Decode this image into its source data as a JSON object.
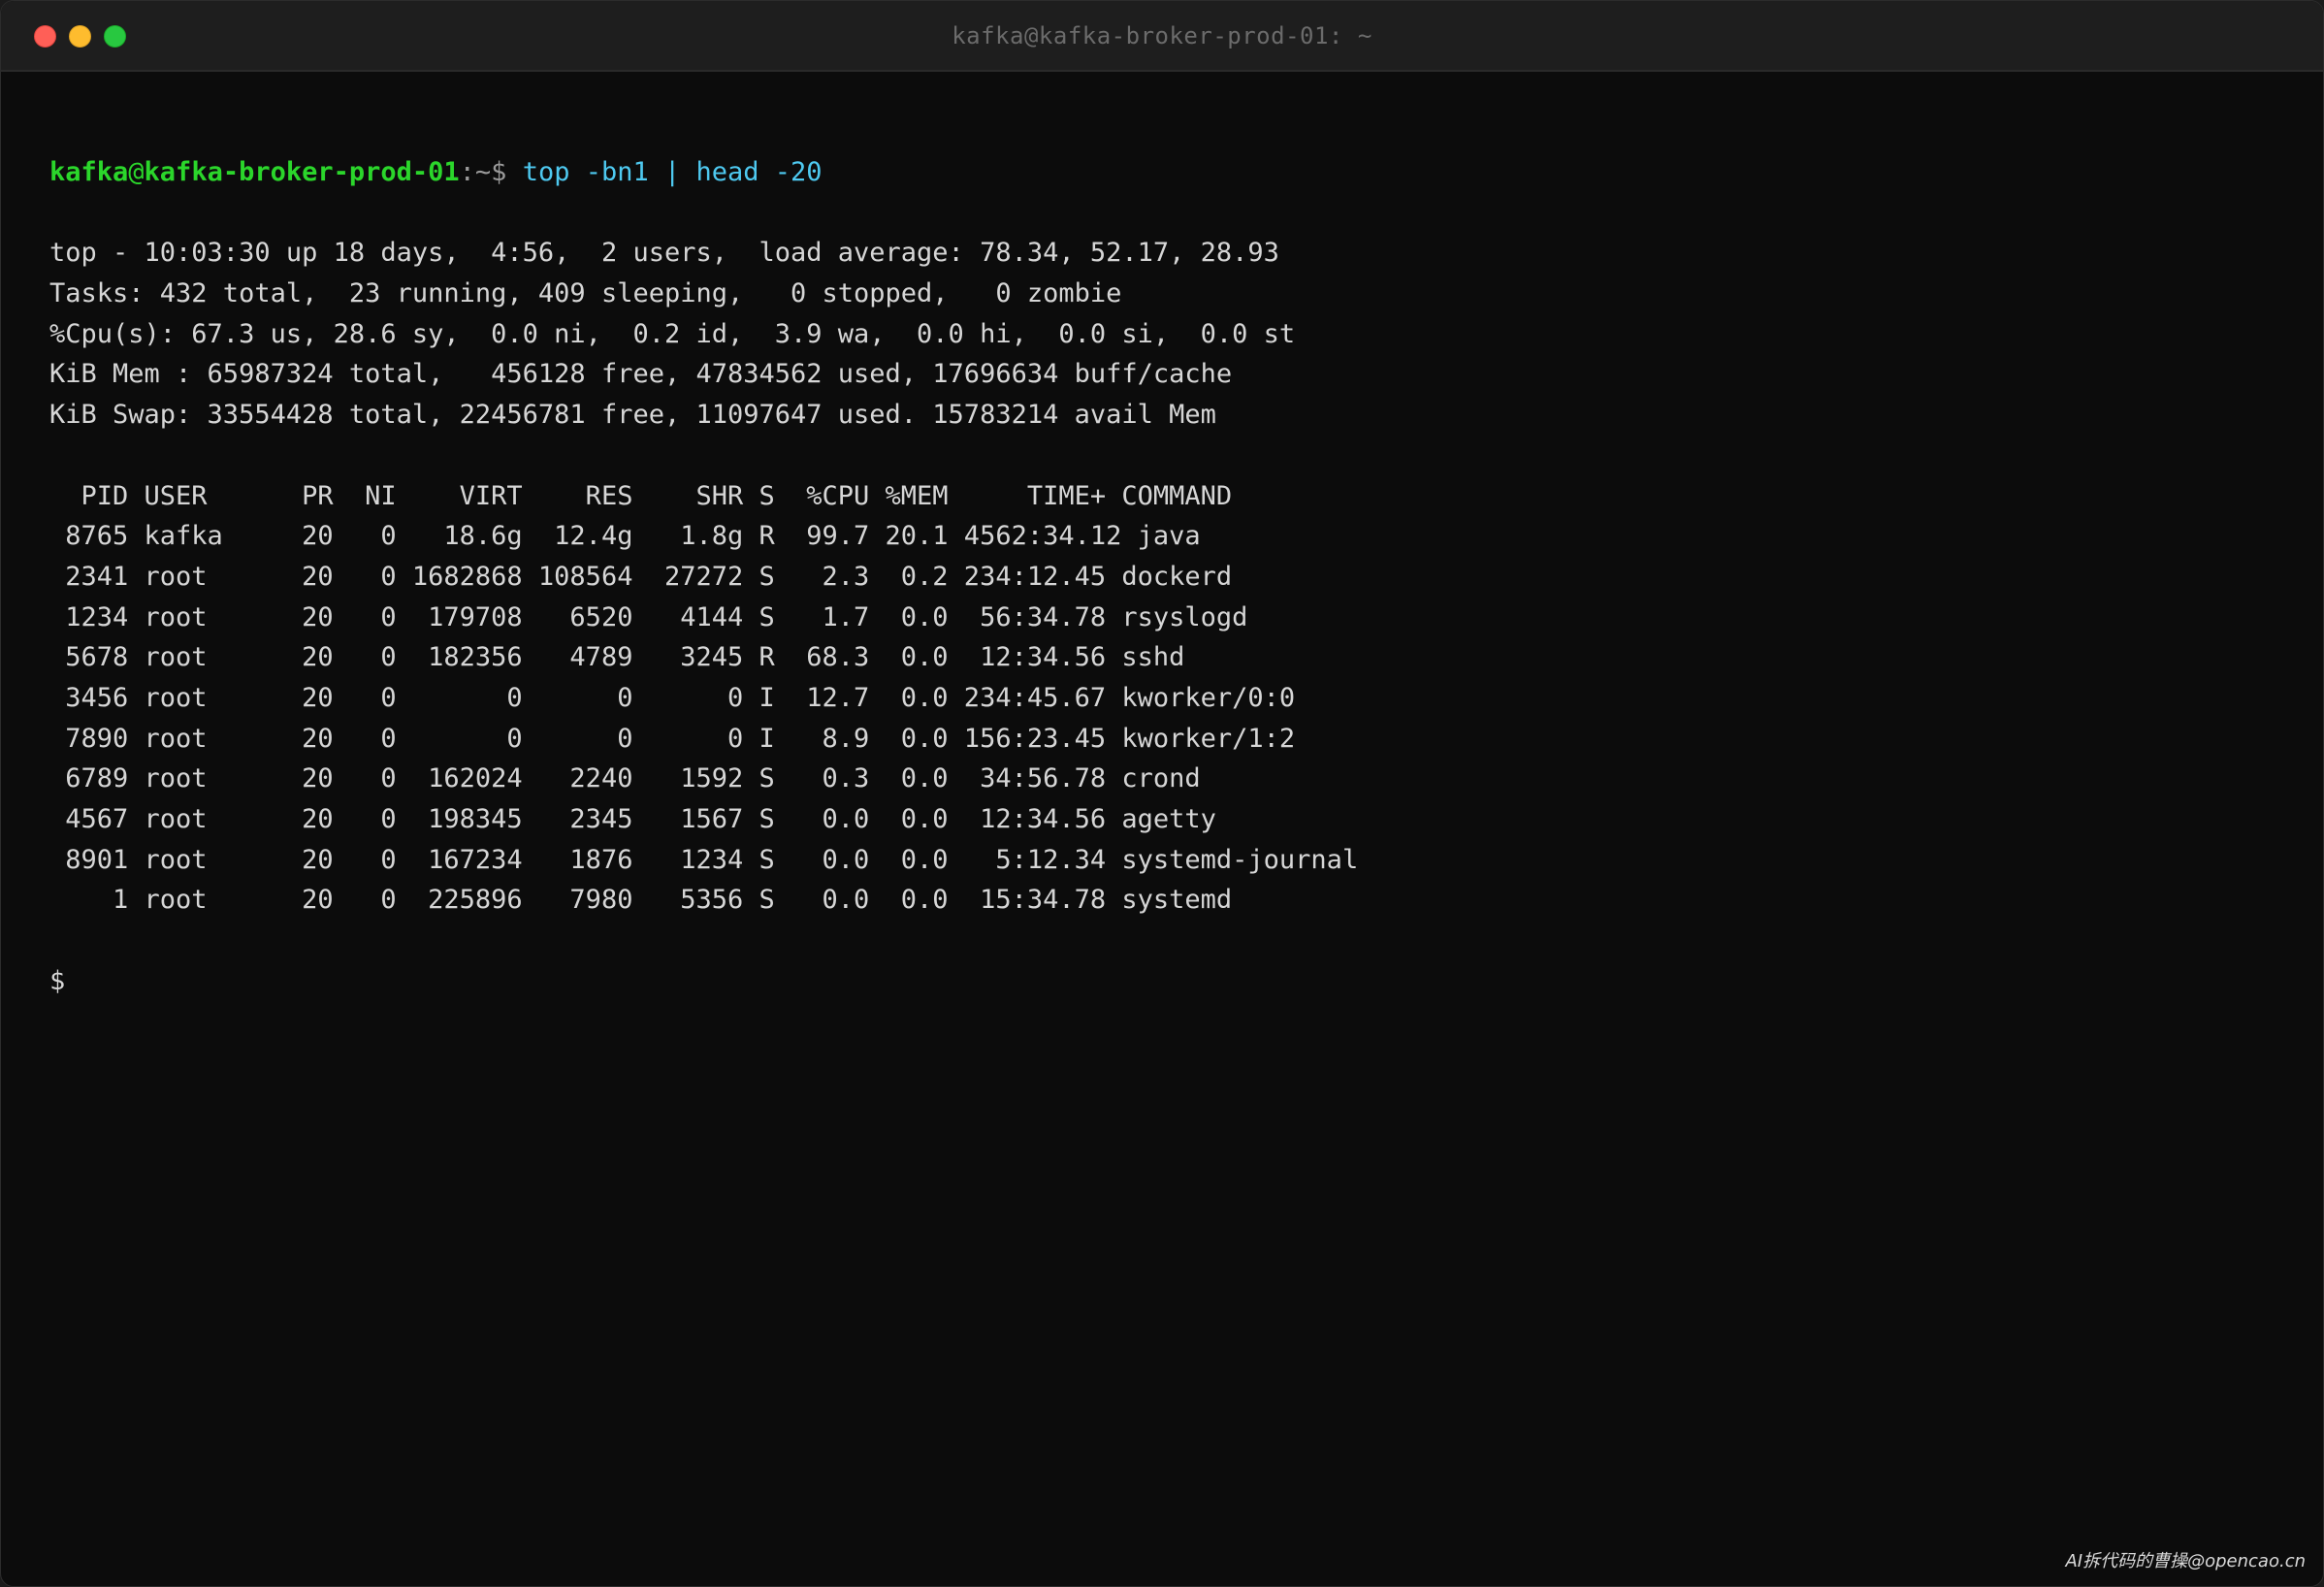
{
  "window": {
    "title": "kafka@kafka-broker-prod-01: ~",
    "colors": {
      "background": "#0c0c0c",
      "prompt_green": "#2bd62b",
      "command_cyan": "#4ec9f0",
      "text": "#d6d6d6"
    }
  },
  "prompt": {
    "user": "kafka",
    "at": "@",
    "host": "kafka-broker-prod-01",
    "path_symbol": ":~$ ",
    "command": "top -bn1 | head -20"
  },
  "top_summary": [
    "top - 10:03:30 up 18 days,  4:56,  2 users,  load average: 78.34, 52.17, 28.93",
    "Tasks: 432 total,  23 running, 409 sleeping,   0 stopped,   0 zombie",
    "%Cpu(s): 67.3 us, 28.6 sy,  0.0 ni,  0.2 id,  3.9 wa,  0.0 hi,  0.0 si,  0.0 st",
    "KiB Mem : 65987324 total,   456128 free, 47834562 used, 17696634 buff/cache",
    "KiB Swap: 33554428 total, 22456781 free, 11097647 used. 15783214 avail Mem"
  ],
  "process_table": {
    "header": "  PID USER      PR  NI    VIRT    RES    SHR S  %CPU %MEM     TIME+ COMMAND",
    "rows": [
      " 8765 kafka     20   0   18.6g  12.4g   1.8g R  99.7 20.1 4562:34.12 java",
      " 2341 root      20   0 1682868 108564  27272 S   2.3  0.2 234:12.45 dockerd",
      " 1234 root      20   0  179708   6520   4144 S   1.7  0.0  56:34.78 rsyslogd",
      " 5678 root      20   0  182356   4789   3245 R  68.3  0.0  12:34.56 sshd",
      " 3456 root      20   0       0      0      0 I  12.7  0.0 234:45.67 kworker/0:0",
      " 7890 root      20   0       0      0      0 I   8.9  0.0 156:23.45 kworker/1:2",
      " 6789 root      20   0  162024   2240   1592 S   0.3  0.0  34:56.78 crond",
      " 4567 root      20   0  198345   2345   1567 S   0.0  0.0  12:34.56 agetty",
      " 8901 root      20   0  167234   1876   1234 S   0.0  0.0   5:12.34 systemd-journal",
      "    1 root      20   0  225896   7980   5356 S   0.0  0.0  15:34.78 systemd"
    ]
  },
  "final_prompt": "$",
  "watermark": "AI拆代码的曹操@opencao.cn"
}
